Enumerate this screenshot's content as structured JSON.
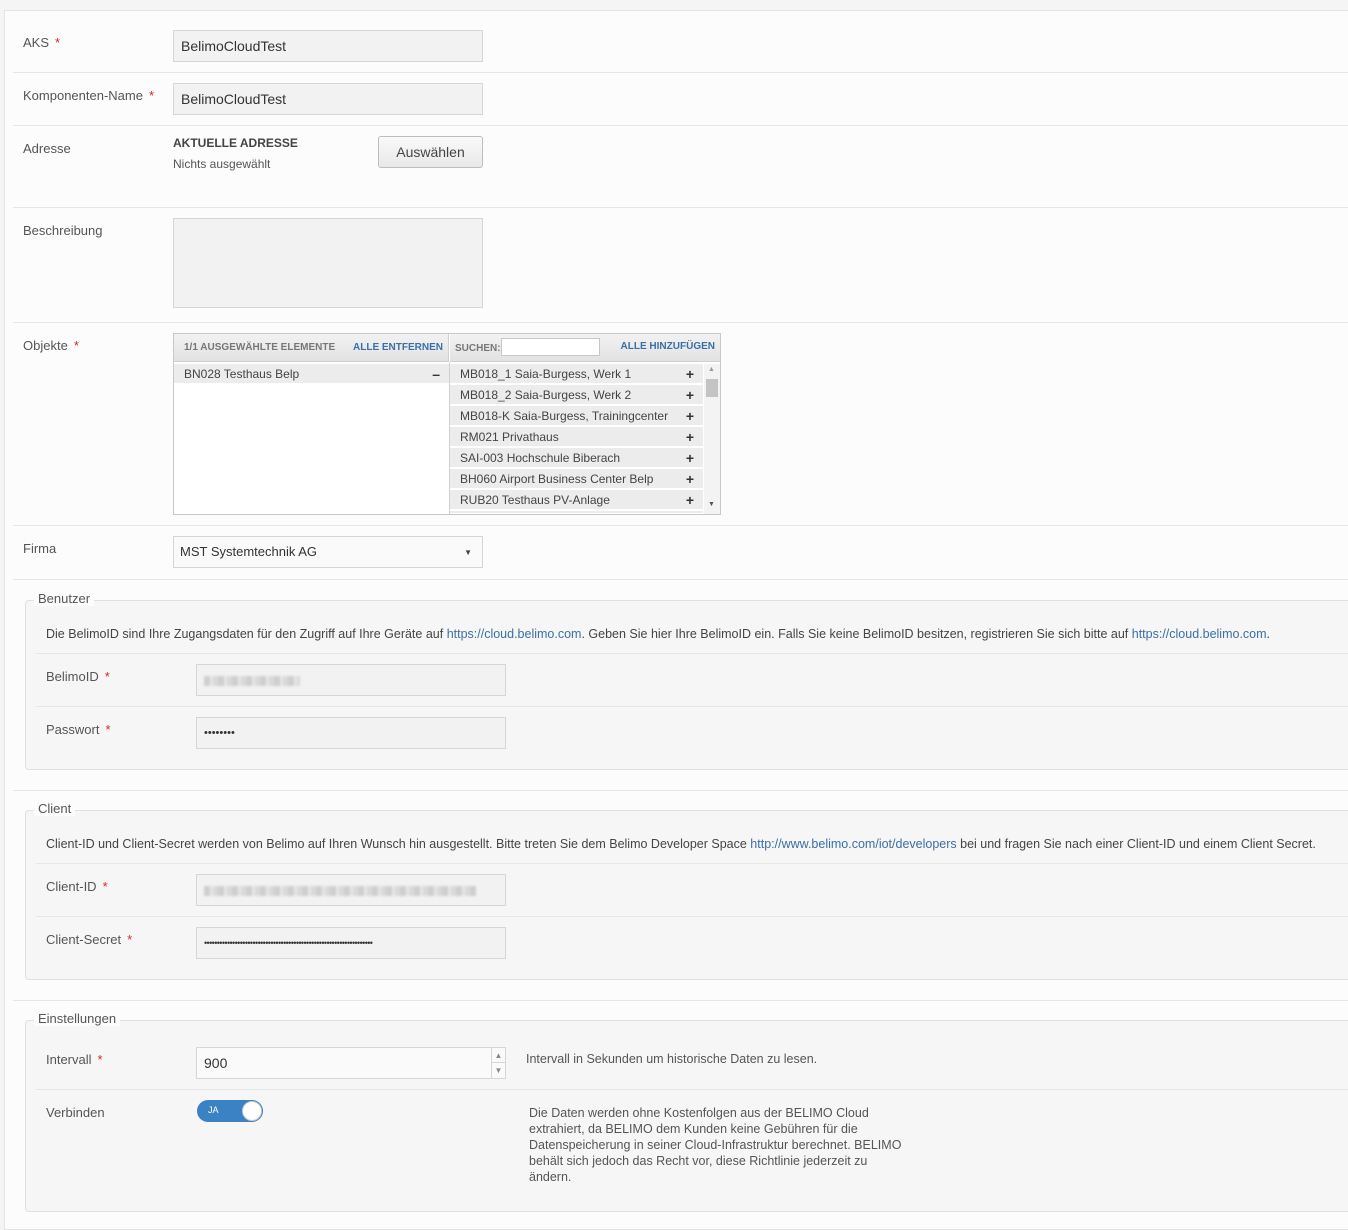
{
  "form": {
    "aks": {
      "label": "AKS",
      "value": "BelimoCloudTest"
    },
    "component_name": {
      "label": "Komponenten-Name",
      "value": "BelimoCloudTest"
    },
    "address": {
      "label": "Adresse",
      "heading": "AKTUELLE ADRESSE",
      "value": "Nichts ausgewählt",
      "button": "Auswählen"
    },
    "description": {
      "label": "Beschreibung",
      "value": ""
    },
    "objects": {
      "label": "Objekte",
      "selected_header": "1/1 AUSGEWÄHLTE ELEMENTE",
      "remove_all": "ALLE ENTFERNEN",
      "search_label": "SUCHEN:",
      "search_value": "",
      "add_all": "ALLE HINZUFÜGEN",
      "selected": [
        "BN028 Testhaus Belp"
      ],
      "available": [
        "MB018_1 Saia-Burgess, Werk 1",
        "MB018_2 Saia-Burgess, Werk 2",
        "MB018-K Saia-Burgess, Trainingcenter",
        "RM021 Privathaus",
        "SAI-003 Hochschule Biberach",
        "BH060 Airport Business Center Belp",
        "RUB20 Testhaus PV-Anlage"
      ]
    },
    "company": {
      "label": "Firma",
      "value": "MST Systemtechnik AG"
    }
  },
  "user_section": {
    "legend": "Benutzer",
    "info_pre": "Die BelimoID sind Ihre Zugangsdaten für den Zugriff auf Ihre Geräte auf ",
    "info_link1": "https://cloud.belimo.com",
    "info_mid": ". Geben Sie hier Ihre BelimoID ein. Falls Sie keine BelimoID besitzen, registrieren Sie sich bitte auf ",
    "info_link2": "https://cloud.belimo.com",
    "info_post": ".",
    "belimo_id_label": "BelimoID",
    "password_label": "Passwort",
    "password_value": "••••••••"
  },
  "client_section": {
    "legend": "Client",
    "info_pre": "Client-ID und Client-Secret werden von Belimo auf Ihren Wunsch hin ausgestellt. Bitte treten Sie dem Belimo Developer Space ",
    "info_link": "http://www.belimo.com/iot/developers",
    "info_post": " bei und fragen Sie nach einer Client-ID und einem Client Secret.",
    "client_id_label": "Client-ID",
    "client_secret_label": "Client-Secret",
    "client_secret_value": "••••••••••••••••••••••••••••••••••••••••••••••••••••••••••••••••••"
  },
  "settings_section": {
    "legend": "Einstellungen",
    "interval_label": "Intervall",
    "interval_value": "900",
    "interval_help": "Intervall in Sekunden um historische Daten zu lesen.",
    "connect_label": "Verbinden",
    "connect_toggle": "JA",
    "connect_help": "Die Daten werden ohne Kostenfolgen aus der BELIMO Cloud extrahiert, da BELIMO dem Kunden keine Gebühren für die Datenspeicherung in seiner Cloud-Infrastruktur berechnet. BELIMO behält sich jedoch das Recht vor, diese Richtlinie jederzeit zu ändern."
  },
  "required_marker": "*",
  "icons": {
    "minus": "minus-icon",
    "plus": "plus-icon",
    "dropdown": "chevron-down-icon",
    "scroll_up": "arrow-up-icon",
    "scroll_down": "arrow-down-icon"
  },
  "colors": {
    "link": "#3b6fa5",
    "required": "#e02222",
    "toggle_on": "#3b82c4"
  }
}
